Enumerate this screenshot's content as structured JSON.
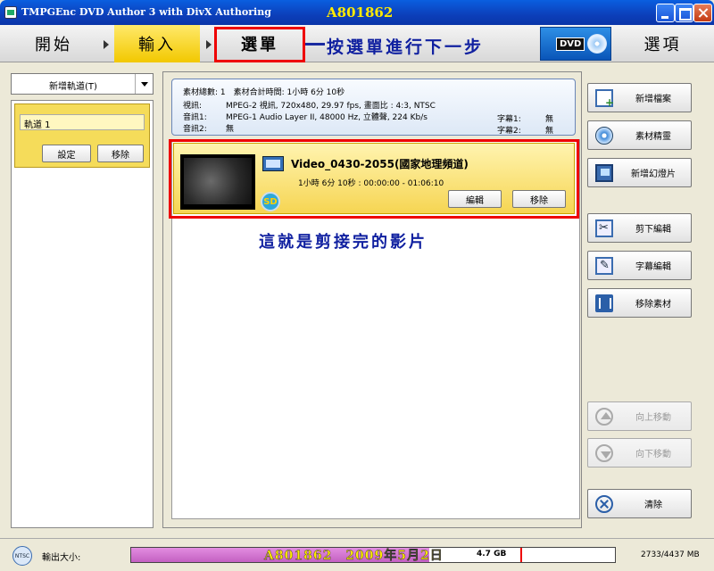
{
  "window": {
    "title": "TMPGEnc DVD Author 3 with DivX Authoring",
    "watermark": "A801862"
  },
  "steps": {
    "start": "開始",
    "input": "輸入",
    "menu": "選單",
    "options": "選項",
    "dvd_badge": "DVD"
  },
  "annotations": {
    "menu_hint": "按選單進行下一步",
    "clip_hint": "這就是剪接完的影片"
  },
  "tracks": {
    "dropdown_label": "新增軌道(T)",
    "items": [
      {
        "name": "軌道 1",
        "set_label": "設定",
        "remove_label": "移除"
      }
    ]
  },
  "info": {
    "line1": "素材總數: 1　素材合計時間: 1小時 6分 10秒",
    "video_key": "視訊:",
    "video_val": "MPEG-2 視訊, 720x480, 29.97 fps, 畫面比 : 4:3, NTSC",
    "audio1_key": "音訊1:",
    "audio1_val": "MPEG-1 Audio Layer II, 48000 Hz, 立體聲, 224 Kb/s",
    "audio2_key": "音訊2:",
    "audio2_val": "無",
    "sub1_key": "字幕1:",
    "sub1_val": "無",
    "sub2_key": "字幕2:",
    "sub2_val": "無"
  },
  "clip": {
    "title": "Video_0430-2055(國家地理頻道)",
    "duration": "1小時 6分 10秒 :  00:00:00 - 01:06:10",
    "edit_label": "編輯",
    "remove_label": "移除",
    "sd_badge": "SD"
  },
  "right_panel": {
    "new_file": "新增檔案",
    "wizard": "素材精靈",
    "new_slideshow": "新增幻燈片",
    "cut_edit": "剪下編輯",
    "subtitle_edit": "字幕編輯",
    "remove_material": "移除素材",
    "move_up": "向上移動",
    "move_down": "向下移動",
    "clear": "清除"
  },
  "status": {
    "format": "NTSC",
    "output_label": "輸出大小:",
    "watermark": "A801862　2009年5月2日",
    "capacity_label": "4.7 GB",
    "size_ratio": "2733/4437 MB",
    "used_mb": 2733,
    "total_mb": 4437
  },
  "colors": {
    "accent_yellow": "#f2c800",
    "highlight_red": "#e00000",
    "annotation_blue": "#1020a0",
    "fill_purple": "#c460c2"
  }
}
